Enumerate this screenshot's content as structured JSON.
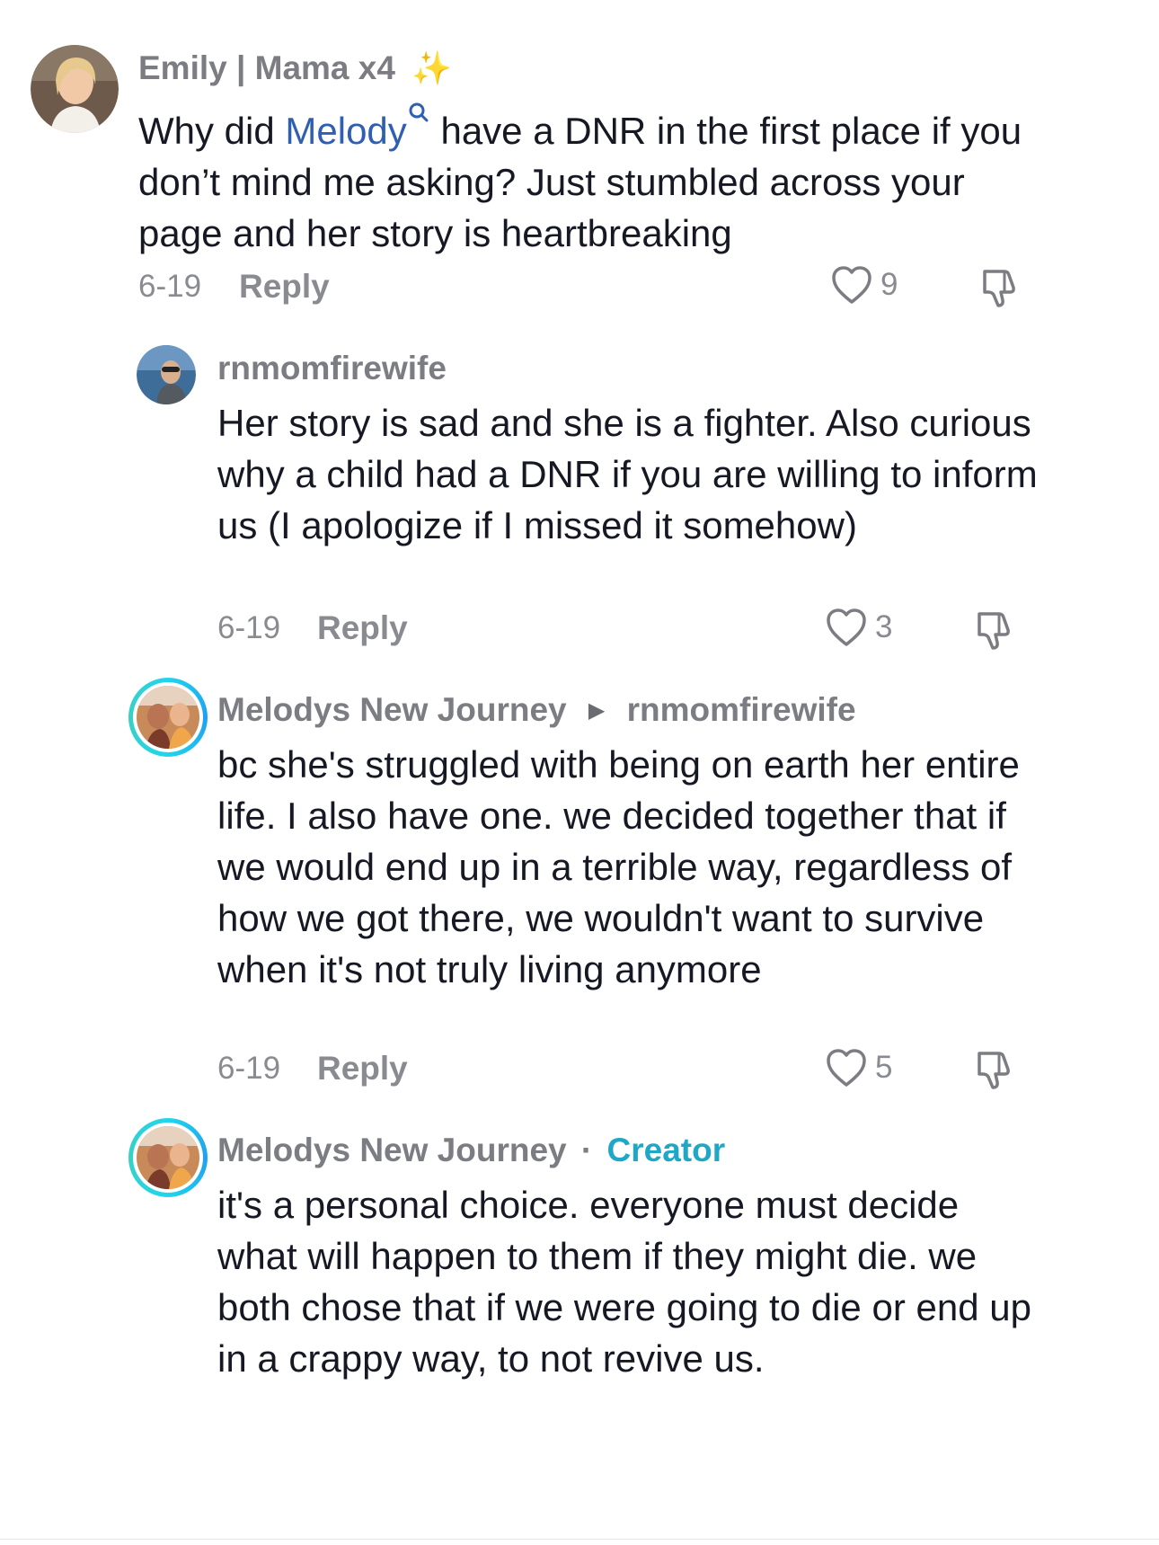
{
  "comments": [
    {
      "username": "Emily | Mama x4",
      "username_emoji": "✨",
      "text_before": "Why did ",
      "mention": "Melody",
      "text_after": " have a DNR in the first place if you don’t mind me asking? Just stumbled across your page and her story is heartbreaking",
      "date": "6-19",
      "reply_label": "Reply",
      "likes": "9"
    },
    {
      "username": "rnmomfirewife",
      "text": "Her story is sad and she is a fighter. Also curious why a child had a DNR if you are willing to inform us (I apologize if I missed it somehow)",
      "date": "6-19",
      "reply_label": "Reply",
      "likes": "3"
    },
    {
      "username": "Melodys New Journey",
      "reply_to": "rnmomfirewife",
      "text": "bc she's struggled with being on earth her entire life. I also have one. we decided together that if we would end up in a terrible way, regardless of how we got there, we wouldn't want to survive when it's not truly living anymore",
      "date": "6-19",
      "reply_label": "Reply",
      "likes": "5"
    },
    {
      "username": "Melodys New Journey",
      "separator": "·",
      "badge": "Creator",
      "text": "it's a personal choice. everyone must decide what will happen to them if they might die. we both chose that if we were going to die or end up in a crappy way, to not revive us."
    }
  ],
  "icons": {
    "like": "heart-outline-icon",
    "dislike": "thumbs-down-icon",
    "mention": "search-icon",
    "reply_arrow": "triangle-right-icon"
  },
  "colors": {
    "mention": "#2f5fb3",
    "creator_badge": "#1fa7c7",
    "ring": "#20d5ec"
  }
}
